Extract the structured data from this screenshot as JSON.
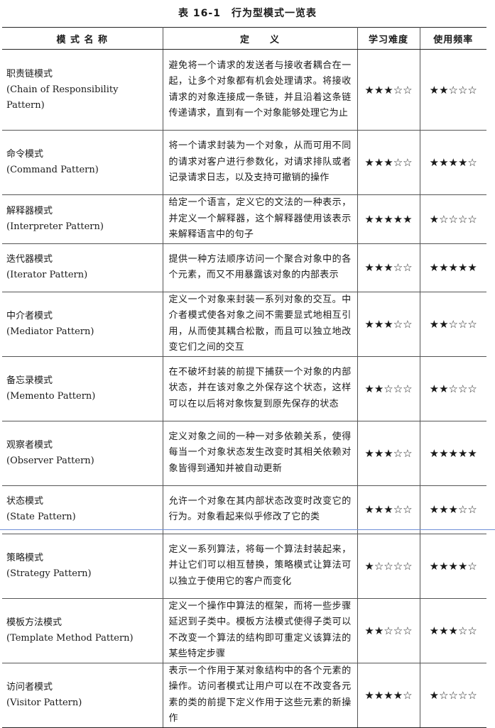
{
  "caption": "表 16-1　行为型模式一览表",
  "headers": [
    "模 式 名 称",
    "定　　义",
    "学习难度",
    "使用频率"
  ],
  "rows": [
    {
      "name": "职责链模式",
      "en": "(Chain of Responsibility Pattern)",
      "definition": "避免将一个请求的发送者与接收者耦合在一起，让多个对象都有机会处理请求。将接收请求的对象连接成一条链，并且沿着这条链传递请求，直到有一个对象能够处理它为止",
      "difficulty": "★★★☆☆",
      "frequency": "★★☆☆☆"
    },
    {
      "name": "命令模式",
      "en": "(Command Pattern)",
      "definition": "将一个请求封装为一个对象，从而可用不同的请求对客户进行参数化，对请求排队或者记录请求日志，以及支持可撤销的操作",
      "difficulty": "★★★☆☆",
      "frequency": "★★★★☆"
    },
    {
      "name": "解释器模式",
      "en": "(Interpreter Pattern)",
      "definition": "给定一个语言，定义它的文法的一种表示，并定义一个解释器，这个解释器使用该表示来解释语言中的句子",
      "difficulty": "★★★★★",
      "frequency": "★☆☆☆☆"
    },
    {
      "name": "迭代器模式",
      "en": "(Iterator Pattern)",
      "definition": "提供一种方法顺序访问一个聚合对象中的各个元素，而又不用暴露该对象的内部表示",
      "difficulty": "★★★☆☆",
      "frequency": "★★★★★"
    },
    {
      "name": "中介者模式",
      "en": "(Mediator Pattern)",
      "definition": "定义一个对象来封装一系列对象的交互。中介者模式使各对象之间不需要显式地相互引用，从而使其耦合松散，而且可以独立地改变它们之间的交互",
      "difficulty": "★★★☆☆",
      "frequency": "★★☆☆☆"
    },
    {
      "name": "备忘录模式",
      "en": "(Memento Pattern)",
      "definition": "在不破坏封装的前提下捕获一个对象的内部状态，并在该对象之外保存这个状态，这样可以在以后将对象恢复到原先保存的状态",
      "difficulty": "★★☆☆☆",
      "frequency": "★★☆☆☆"
    },
    {
      "name": "观察者模式",
      "en": "(Observer Pattern)",
      "definition": "定义对象之间的一种一对多依赖关系，使得每当一个对象状态发生改变时其相关依赖对象皆得到通知并被自动更新",
      "difficulty": "★★★☆☆",
      "frequency": "★★★★★"
    },
    {
      "name": "状态模式",
      "en": "(State Pattern)",
      "definition": "允许一个对象在其内部状态改变时改变它的行为。对象看起来似乎修改了它的类",
      "difficulty": "★★★☆☆",
      "frequency": "★★★☆☆"
    },
    {
      "name": "策略模式",
      "en": "(Strategy Pattern)",
      "definition": "定义一系列算法，将每一个算法封装起来，并让它们可以相互替换，策略模式让算法可以独立于使用它的客户而变化",
      "difficulty": "★☆☆☆☆",
      "frequency": "★★★★☆"
    },
    {
      "name": "模板方法模式",
      "en": "(Template Method Pattern)",
      "definition": "定义一个操作中算法的框架，而将一些步骤延迟到子类中。模板方法模式使得子类可以不改变一个算法的结构即可重定义该算法的某些特定步骤",
      "difficulty": "★★☆☆☆",
      "frequency": "★★★☆☆"
    },
    {
      "name": "访问者模式",
      "en": "(Visitor Pattern)",
      "definition": "表示一个作用于某对象结构中的各个元素的操作。访问者模式让用户可以在不改变各元素的类的前提下定义作用于这些元素的新操作",
      "difficulty": "★★★★☆",
      "frequency": "★☆☆☆☆"
    }
  ]
}
